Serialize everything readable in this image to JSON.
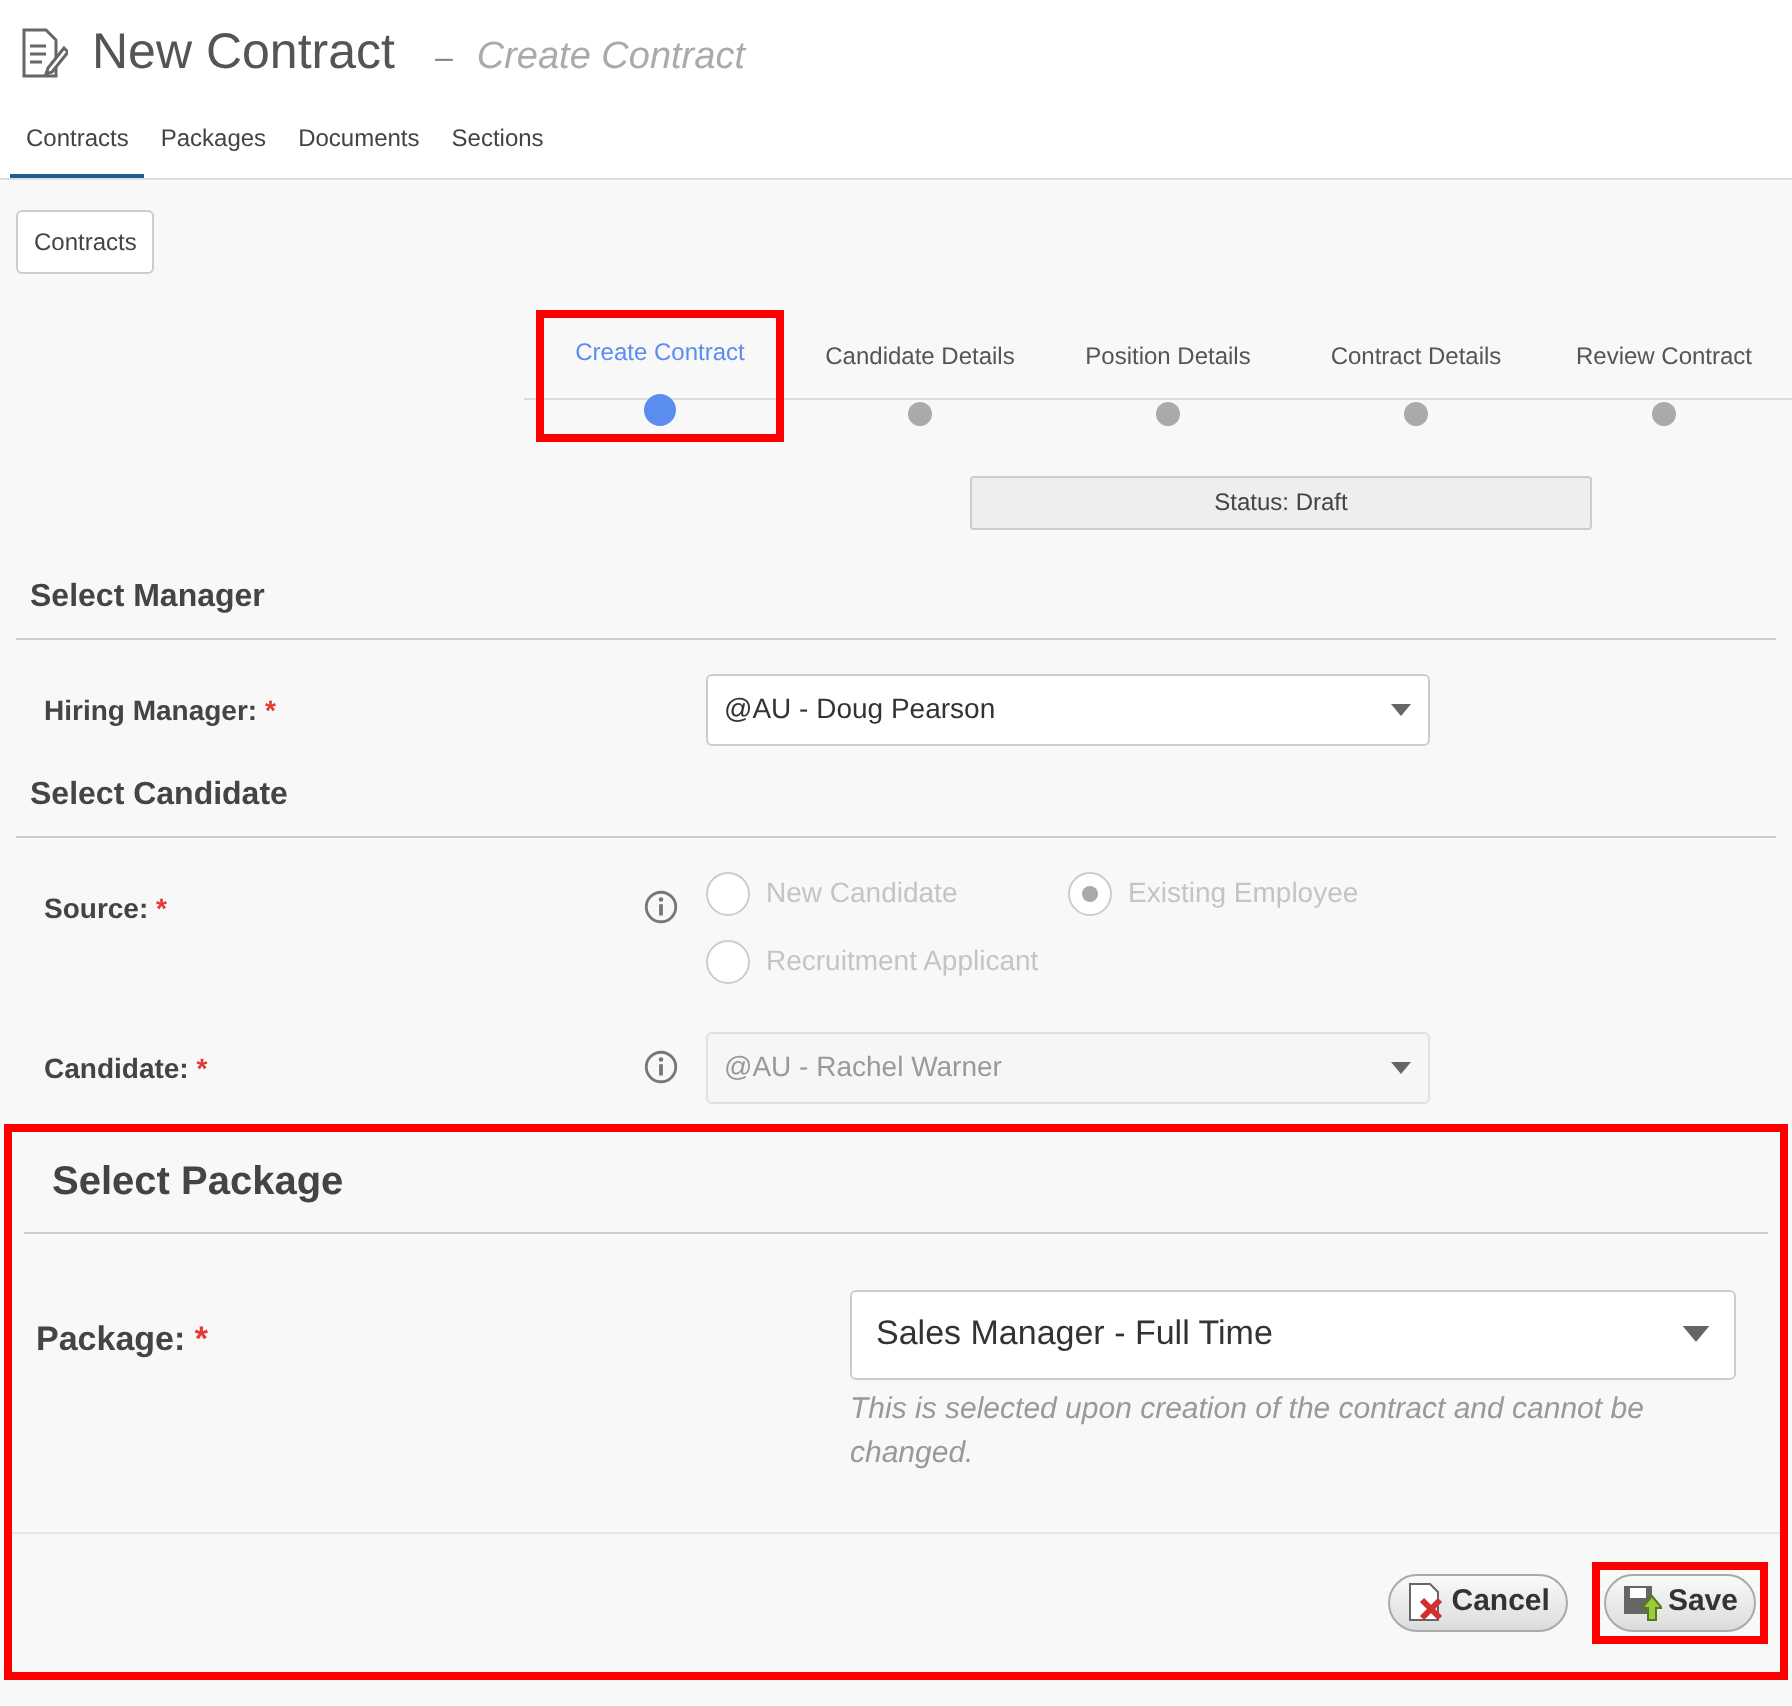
{
  "header": {
    "title": "New Contract",
    "separator": "–",
    "subtitle": "Create Contract"
  },
  "tabs": [
    {
      "label": "Contracts",
      "selected": true
    },
    {
      "label": "Packages",
      "selected": false
    },
    {
      "label": "Documents",
      "selected": false
    },
    {
      "label": "Sections",
      "selected": false
    }
  ],
  "breadcrumb_button": "Contracts",
  "steps": [
    {
      "label": "Create Contract",
      "selected": true,
      "highlighted": true
    },
    {
      "label": "Candidate Details",
      "selected": false,
      "highlighted": false
    },
    {
      "label": "Position Details",
      "selected": false,
      "highlighted": false
    },
    {
      "label": "Contract Details",
      "selected": false,
      "highlighted": false
    },
    {
      "label": "Review Contract",
      "selected": false,
      "highlighted": false
    }
  ],
  "status": "Status: Draft",
  "sections": [
    {
      "title": "Select Manager",
      "highlighted": false,
      "fields": [
        {
          "kind": "select",
          "label": "Hiring Manager:",
          "required": "*",
          "info": false,
          "value": "@AU - Doug Pearson",
          "disabled": false
        }
      ]
    },
    {
      "title": "Select Candidate",
      "highlighted": false,
      "fields": [
        {
          "kind": "radio",
          "label": "Source:",
          "required": "*",
          "info": true,
          "disabled": true,
          "options": [
            {
              "label": "New Candidate",
              "selected": false
            },
            {
              "label": "Existing Employee",
              "selected": true
            },
            {
              "label": "Recruitment Applicant",
              "selected": false
            }
          ]
        },
        {
          "kind": "select",
          "label": "Candidate:",
          "required": "*",
          "info": true,
          "value": "@AU - Rachel Warner",
          "disabled": true
        }
      ]
    },
    {
      "title": "Select Package",
      "highlighted": true,
      "fields": [
        {
          "kind": "select",
          "label": "Package:",
          "required": "*",
          "info": false,
          "value": "Sales Manager - Full Time",
          "disabled": false,
          "help": "This is selected upon creation of the contract and cannot be changed."
        }
      ]
    }
  ],
  "buttons": [
    {
      "kind": "cancel",
      "label": "Cancel",
      "highlighted": false
    },
    {
      "kind": "save",
      "label": "Save",
      "highlighted": true
    }
  ]
}
